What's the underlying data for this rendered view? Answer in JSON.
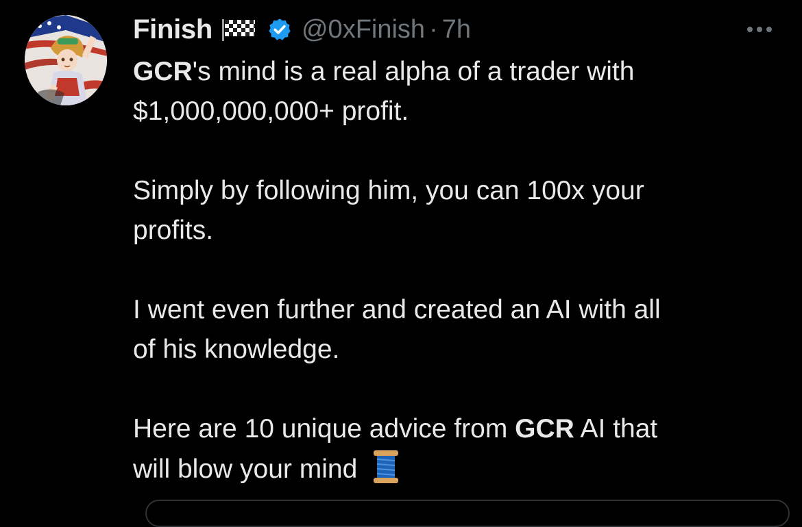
{
  "tweet": {
    "author": {
      "display_name": "Finish",
      "handle": "@0xFinish",
      "separator": "·",
      "time": "7h",
      "avatar_icon": "anime-character-avatar",
      "flag_icon": "checkered-flag-icon",
      "verified_icon": "verified-badge-icon"
    },
    "more_icon": "more-options-icon",
    "text": {
      "p1_line1_bold": "GCR",
      "p1_line1_rest": "'s mind is a real alpha of a trader with",
      "p1_line2": "$1,000,000,000+ profit.",
      "p2_line1": "Simply by following him, you can 100x your",
      "p2_line2": "profits.",
      "p3_line1": "I went even further and created an AI with all",
      "p3_line2": "of his knowledge.",
      "p4_line1_start": "Here are 10 unique advice from ",
      "p4_line1_bold": "GCR",
      "p4_line1_end": " AI that",
      "p4_line2": "will blow your mind",
      "thread_emoji_icon": "spool-of-thread-icon"
    }
  },
  "colors": {
    "background": "#000000",
    "primary_text": "#e7e9ea",
    "secondary_text": "#71767b",
    "verified_blue": "#1d9bf0",
    "border": "#2f3336"
  }
}
